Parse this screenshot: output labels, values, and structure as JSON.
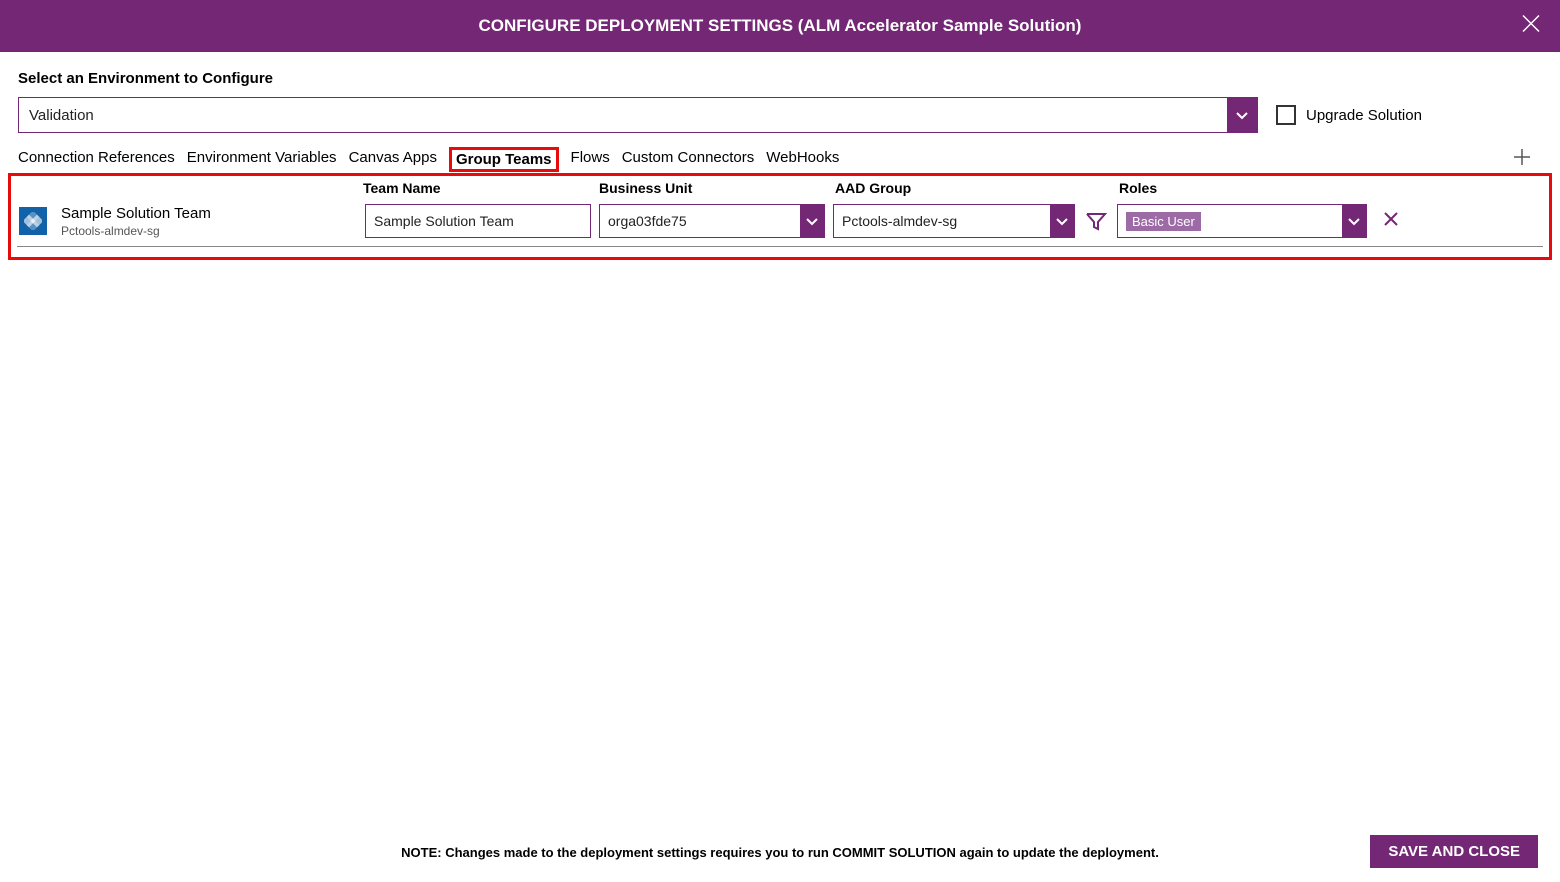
{
  "header": {
    "title": "CONFIGURE DEPLOYMENT SETTINGS (ALM Accelerator Sample Solution)"
  },
  "env": {
    "label": "Select an Environment to Configure",
    "selected": "Validation",
    "upgrade_label": "Upgrade Solution"
  },
  "tabs": [
    {
      "label": "Connection References"
    },
    {
      "label": "Environment Variables"
    },
    {
      "label": "Canvas Apps"
    },
    {
      "label": "Group Teams",
      "selected": true
    },
    {
      "label": "Flows"
    },
    {
      "label": "Custom Connectors"
    },
    {
      "label": "WebHooks"
    }
  ],
  "columns": {
    "team_name": "Team Name",
    "business_unit": "Business Unit",
    "aad_group": "AAD Group",
    "roles": "Roles"
  },
  "rows": [
    {
      "display_name": "Sample Solution Team",
      "display_sub": "Pctools-almdev-sg",
      "team_name": "Sample Solution Team",
      "business_unit": "orga03fde75",
      "aad_group": "Pctools-almdev-sg",
      "role_tag": "Basic User"
    }
  ],
  "footer": {
    "note": "NOTE: Changes made to the deployment settings requires you to run COMMIT SOLUTION again to update the deployment.",
    "save_label": "SAVE AND CLOSE"
  }
}
